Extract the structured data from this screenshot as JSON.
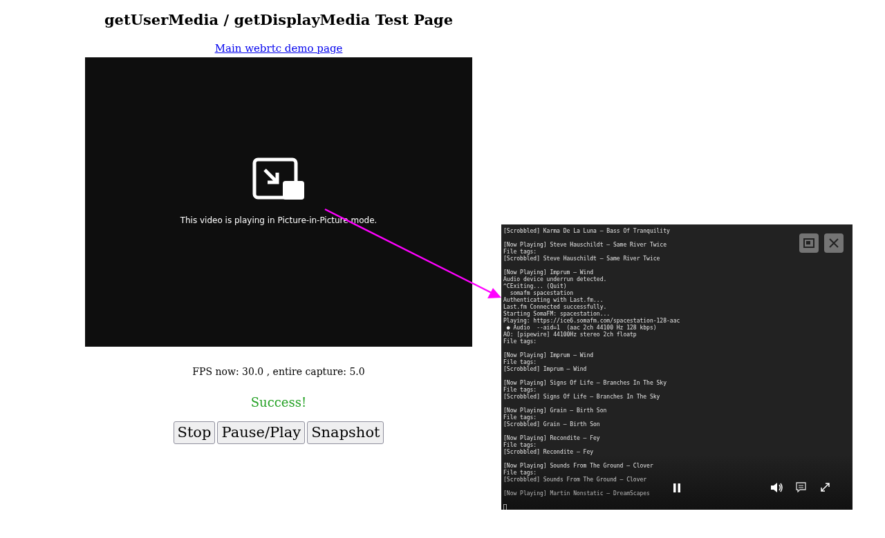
{
  "page": {
    "title": "getUserMedia / getDisplayMedia Test Page",
    "link": "Main webrtc demo page"
  },
  "video": {
    "pip_message": "This video is playing in Picture-in-Picture mode."
  },
  "stats": {
    "fps": "FPS now: 30.0 , entire capture: 5.0",
    "status": "Success!"
  },
  "buttons": [
    "Stop",
    "Pause/Play",
    "Snapshot"
  ],
  "pip_window": {
    "terminal_blocks": [
      [
        "[Scrobbled] Karma De La Luna – Bass Of Tranquility"
      ],
      [
        "[Now Playing] Steve Hauschildt – Same River Twice",
        "File tags:",
        "[Scrobbled] Steve Hauschildt – Same River Twice"
      ],
      [
        "[Now Playing] Imprum – Wind",
        "Audio device underrun detected.",
        "^CExiting... (Quit)",
        "  somafm spacestation",
        "Authenticating with Last.fm...",
        "Last.fm Connected successfully.",
        "Starting SomaFM: spacestation...",
        "Playing: https://ice6.somafm.com/spacestation-128-aac",
        " ● Audio  --aid=1  (aac 2ch 44100 Hz 128 kbps)",
        "AO: [pipewire] 44100Hz stereo 2ch floatp",
        "File tags:"
      ],
      [
        "[Now Playing] Imprum – Wind",
        "File tags:",
        "[Scrobbled] Imprum – Wind"
      ],
      [
        "[Now Playing] Signs Of Life – Branches In The Sky",
        "File tags:",
        "[Scrobbled] Signs Of Life – Branches In The Sky"
      ],
      [
        "[Now Playing] Grain – Birth Son",
        "File tags:",
        "[Scrobbled] Grain – Birth Son"
      ],
      [
        "[Now Playing] Recondite – Fey",
        "File tags:",
        "[Scrobbled] Recondite – Fey"
      ],
      [
        "[Now Playing] Sounds From The Ground – Clover",
        "File tags:",
        "[Scrobbled] Sounds From The Ground – Clover"
      ],
      [
        "[Now Playing] Martin Nonstatic – DreamScapes"
      ]
    ]
  }
}
